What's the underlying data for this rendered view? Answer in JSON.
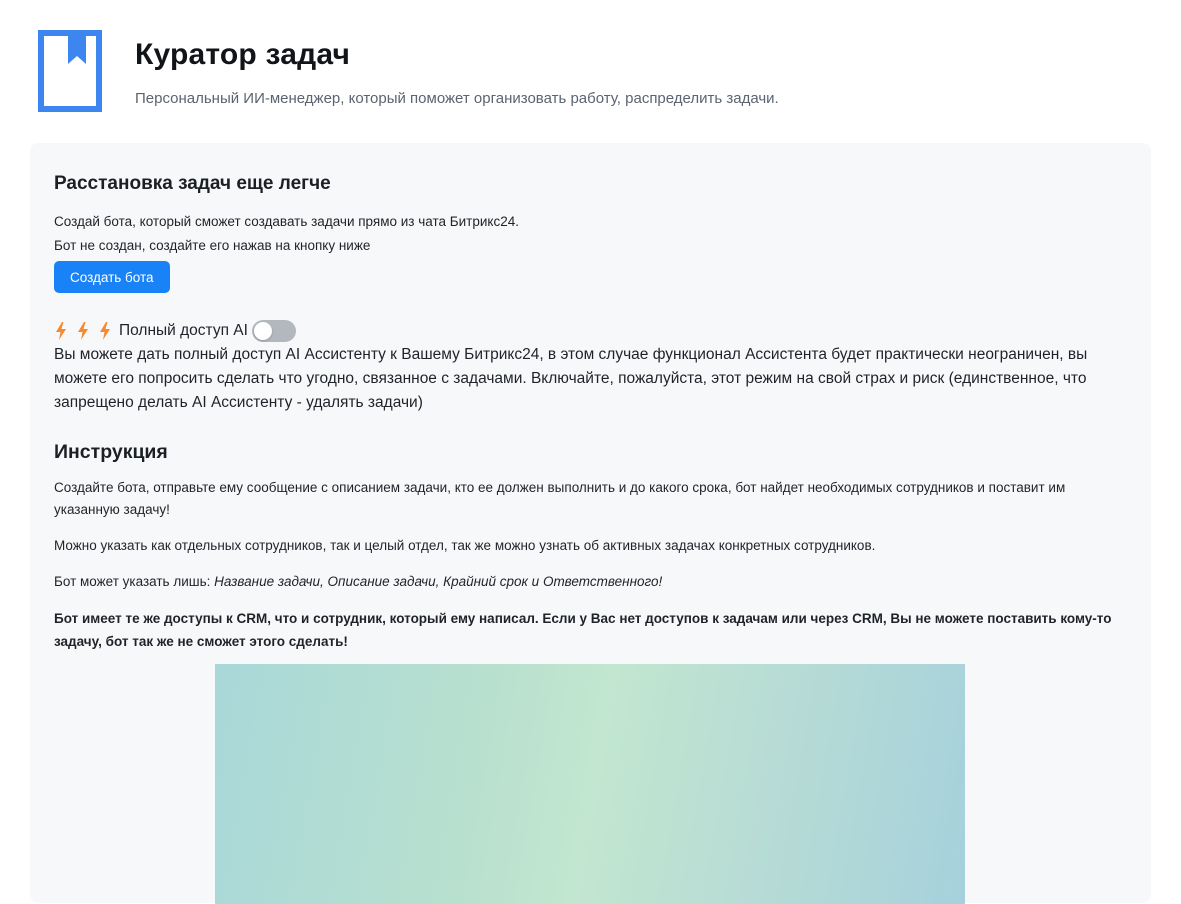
{
  "header": {
    "logo_icon": "bookmark-book-icon",
    "title": "Куратор задач",
    "subtitle": "Персональный ИИ-менеджер, который поможет организовать работу, распределить задачи."
  },
  "bot_section": {
    "title": "Расстановка задач еще легче",
    "desc_line1": "Создай бота, который сможет создавать задачи прямо из чата Битрикс24.",
    "desc_line2": "Бот не создан, создайте его нажав на кнопку ниже",
    "create_button_label": "Создать бота"
  },
  "ai_access": {
    "icons": [
      "lightning-icon",
      "lightning-icon",
      "lightning-icon"
    ],
    "label": "Полный доступ AI",
    "toggle_on": false,
    "description": "Вы можете дать полный доступ AI Ассистенту к Вашему Битрикс24, в этом случае функционал Ассистента будет практически неограничен, вы можете его попросить сделать что угодно, связанное с задачами. Включайте, пожалуйста, этот режим на свой страх и риск (единственное, что запрещено делать AI Ассистенту - удалять задачи)"
  },
  "instruction": {
    "title": "Инструкция",
    "p1": "Создайте бота, отправьте ему сообщение с описанием задачи, кто ее должен выполнить и до какого срока, бот найдет необходимых сотрудников и поставит им указанную задачу!",
    "p2": "Можно указать как отдельных сотрудников, так и целый отдел, так же можно узнать об активных задачах конкретных сотрудников.",
    "p3_prefix": "Бот может указать лишь: ",
    "p3_italic": "Название задачи, Описание задачи, Крайний срок и Ответственного!",
    "p4": "Бот имеет те же доступы к CRM, что и сотрудник, который ему написал. Если у Вас нет доступов к задачам или через CRM, Вы не можете поставить кому-то задачу, бот так же не сможет этого сделать!"
  },
  "colors": {
    "accent": "#1a82f7",
    "logo": "#3d86f0",
    "bolt": "#f58a2f",
    "panel_bg": "#f7f8fa"
  }
}
